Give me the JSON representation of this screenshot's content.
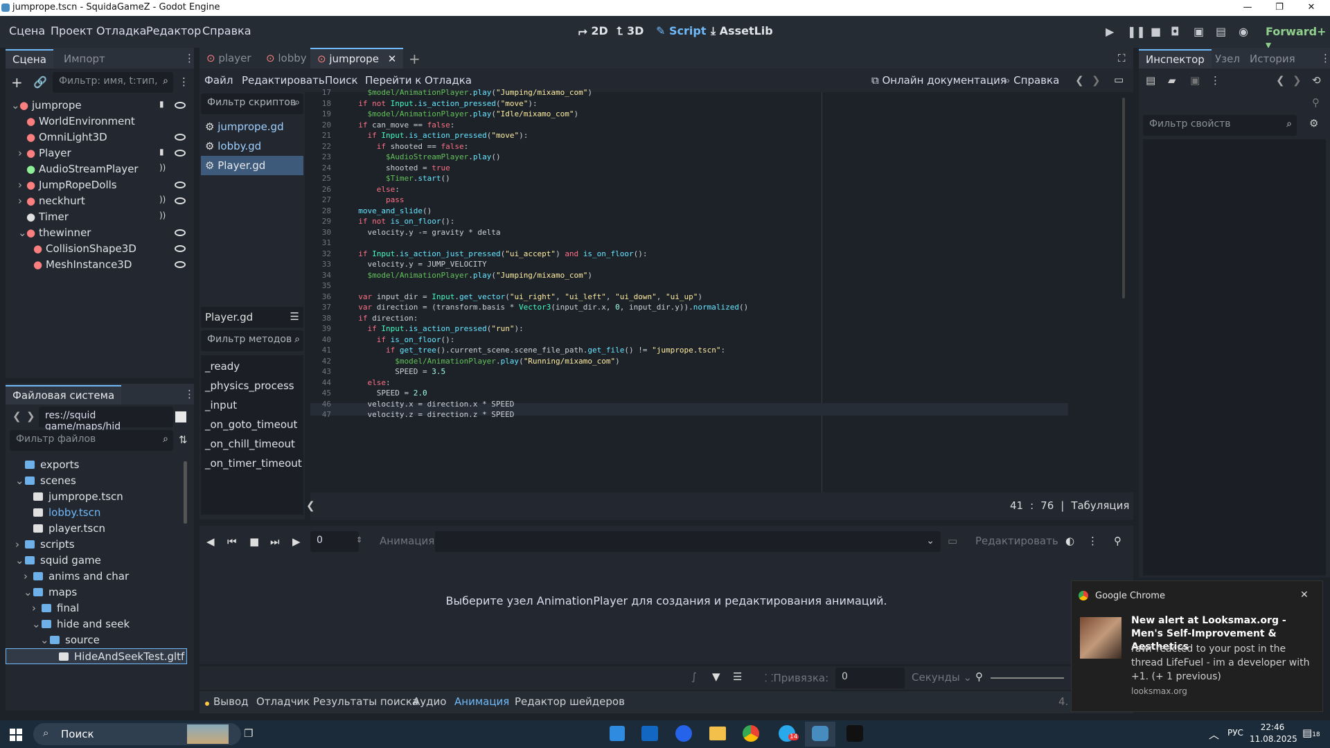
{
  "window": {
    "title": "jumprope.tscn - SquidaGameZ - Godot Engine"
  },
  "menubar": {
    "items": [
      "Сцена",
      "Проект",
      "Отладка",
      "Редактор",
      "Справка"
    ],
    "modes": [
      {
        "label": "2D"
      },
      {
        "label": "3D"
      },
      {
        "label": "Script"
      },
      {
        "label": "AssetLib"
      }
    ],
    "renderer": "Forward+"
  },
  "scene_dock": {
    "tabs": [
      "Сцена",
      "Импорт"
    ],
    "filter_placeholder": "Фильтр: имя, t:тип,",
    "nodes": [
      {
        "label": "jumprope",
        "icon": "node3d-icon",
        "color": "#fc7f7f"
      },
      {
        "label": "WorldEnvironment",
        "icon": "globe-icon",
        "color": "#fc7f7f"
      },
      {
        "label": "OmniLight3D",
        "icon": "light-icon",
        "color": "#fc7f7f"
      },
      {
        "label": "Player",
        "icon": "character-icon",
        "color": "#fc7f7f"
      },
      {
        "label": "AudioStreamPlayer",
        "icon": "audio-icon",
        "color": "#8eef97"
      },
      {
        "label": "JumpRopeDolls",
        "icon": "node3d-icon",
        "color": "#fc7f7f"
      },
      {
        "label": "neckhurt",
        "icon": "area-icon",
        "color": "#fc7f7f"
      },
      {
        "label": "Timer",
        "icon": "timer-icon",
        "color": "#e0e0e0"
      },
      {
        "label": "thewinner",
        "icon": "area-icon",
        "color": "#fc7f7f"
      },
      {
        "label": "CollisionShape3D",
        "icon": "shape-icon",
        "color": "#fc7f7f"
      },
      {
        "label": "MeshInstance3D",
        "icon": "mesh-icon",
        "color": "#fc7f7f"
      }
    ]
  },
  "filesystem": {
    "title": "Файловая система",
    "path": "res://squid game/maps/hid",
    "filter_placeholder": "Фильтр файлов",
    "items": [
      {
        "label": "exports",
        "type": "folder"
      },
      {
        "label": "scenes",
        "type": "folder"
      },
      {
        "label": "jumprope.tscn",
        "type": "scene"
      },
      {
        "label": "lobby.tscn",
        "type": "scene"
      },
      {
        "label": "player.tscn",
        "type": "scene"
      },
      {
        "label": "scripts",
        "type": "folder"
      },
      {
        "label": "squid game",
        "type": "folder"
      },
      {
        "label": "anims and char",
        "type": "folder"
      },
      {
        "label": "maps",
        "type": "folder"
      },
      {
        "label": "final",
        "type": "folder"
      },
      {
        "label": "hide and seek",
        "type": "folder"
      },
      {
        "label": "source",
        "type": "folder"
      },
      {
        "label": "HideAndSeekTest.gltf",
        "type": "file"
      }
    ]
  },
  "editor_tabs": [
    "player",
    "lobby",
    "jumprope"
  ],
  "script_menu": [
    "Файл",
    "Редактировать",
    "Поиск",
    "Перейти к",
    "Отладка"
  ],
  "script_links": {
    "docs": "Онлайн документация",
    "help": "Справка"
  },
  "script_list": {
    "filter": "Фильтр скриптов",
    "files": [
      "jumprope.gd",
      "lobby.gd",
      "Player.gd"
    ],
    "current": "Player.gd",
    "methods_filter": "Фильтр методов",
    "methods": [
      "_ready",
      "_physics_process",
      "_input",
      "_on_goto_timeout",
      "_on_chill_timeout",
      "_on_timer_timeout"
    ]
  },
  "code": {
    "first_line": 17,
    "lines": [
      "    $model/AnimationPlayer.play(\"Jumping/mixamo_com\")",
      "  if not Input.is_action_pressed(\"move\"):",
      "    $model/AnimationPlayer.play(\"Idle/mixamo_com\")",
      "  if can_move == false:",
      "    if Input.is_action_pressed(\"move\"):",
      "      if shooted == false:",
      "        $AudioStreamPlayer.play()",
      "        shooted = true",
      "        $Timer.start()",
      "      else:",
      "        pass",
      "  move_and_slide()",
      "  if not is_on_floor():",
      "    velocity.y -= gravity * delta",
      "",
      "  if Input.is_action_just_pressed(\"ui_accept\") and is_on_floor():",
      "    velocity.y = JUMP_VELOCITY",
      "    $model/AnimationPlayer.play(\"Jumping/mixamo_com\")",
      "",
      "  var input_dir = Input.get_vector(\"ui_right\", \"ui_left\", \"ui_down\", \"ui_up\")",
      "  var direction = (transform.basis * Vector3(input_dir.x, 0, input_dir.y)).normalized()",
      "  if direction:",
      "    if Input.is_action_pressed(\"run\"):",
      "      if is_on_floor():",
      "        if get_tree().current_scene.scene_file_path.get_file() != \"jumprope.tscn\":",
      "          $model/AnimationPlayer.play(\"Running/mixamo_com\")",
      "          SPEED = 3.5",
      "    else:",
      "      SPEED = 2.0",
      "    velocity.x = direction.x * SPEED",
      "    velocity.z = direction.z * SPEED"
    ]
  },
  "status": {
    "line": "41",
    "col": "76",
    "indent": "Табуляция"
  },
  "inspector": {
    "tabs": [
      "Инспектор",
      "Узел",
      "История"
    ],
    "filter_placeholder": "Фильтр свойств"
  },
  "animation": {
    "time": "0",
    "label": "Анимация",
    "edit": "Редактировать",
    "message": "Выберите узел AnimationPlayer для создания и редактирования анимаций.",
    "snap_label": "Привязка:",
    "snap_value": "0",
    "unit": "Секунды"
  },
  "bottom_tabs": [
    "Вывод",
    "Отладчик",
    "Результаты поиска",
    "Аудио",
    "Анимация",
    "Редактор шейдеров"
  ],
  "version": "4.",
  "notification": {
    "app": "Google Chrome",
    "title": "New alert at Looksmax.org - Men's Self-Improvement & Aesthetics",
    "body": "rawr reacted to your post in the thread LifeFuel - im a developer with +1. (+ 1 previous)",
    "source": "looksmax.org"
  },
  "taskbar": {
    "search": "Поиск",
    "lang": "РУС",
    "time": "22:46",
    "date": "11.08.2025",
    "badge": "18",
    "tg_badge": "14"
  }
}
